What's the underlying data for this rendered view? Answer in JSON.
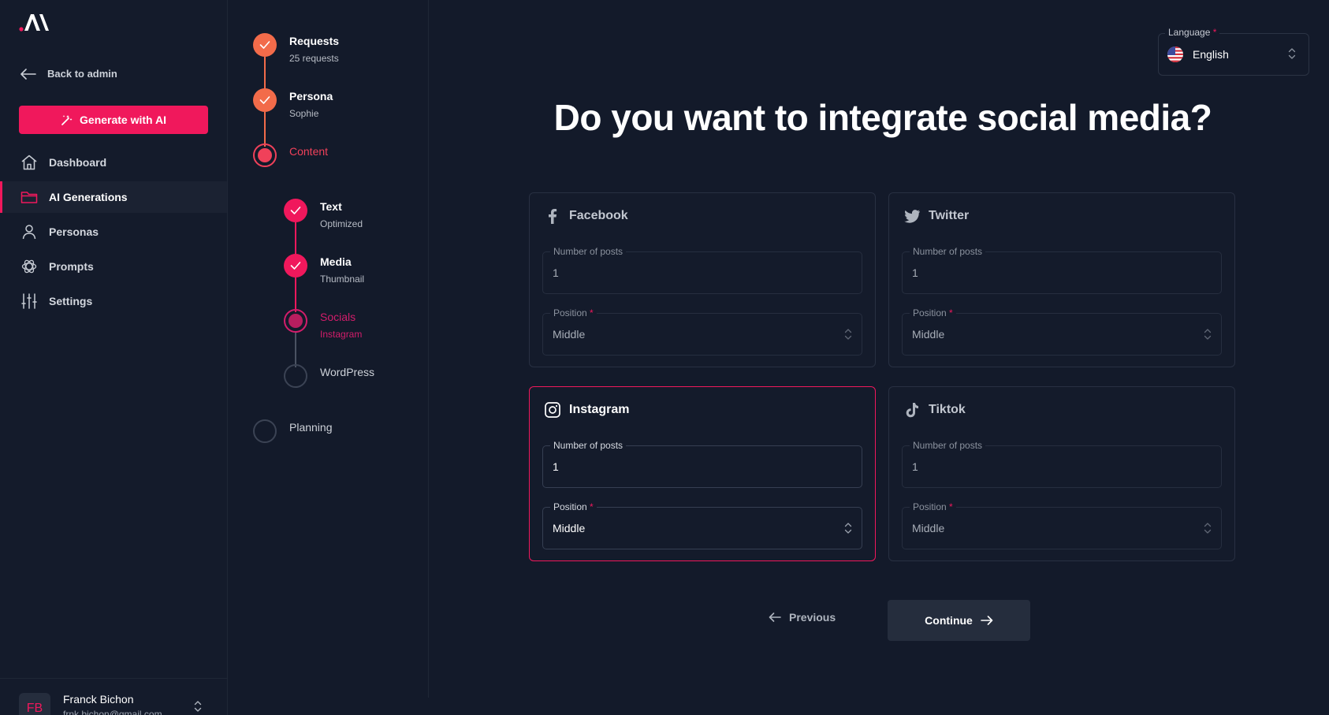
{
  "app": {
    "logo_text": ".AI"
  },
  "sidebar": {
    "back_label": "Back to admin",
    "generate_label": "Generate with AI",
    "items": [
      {
        "label": "Dashboard",
        "icon": "home-icon"
      },
      {
        "label": "AI Generations",
        "icon": "folder-icon",
        "active": true
      },
      {
        "label": "Personas",
        "icon": "user-icon"
      },
      {
        "label": "Prompts",
        "icon": "openai-icon"
      },
      {
        "label": "Settings",
        "icon": "sliders-icon"
      }
    ],
    "user": {
      "initials": "FB",
      "name": "Franck Bichon",
      "email": "frnk.bichon@gmail.com"
    }
  },
  "stepper": {
    "steps": [
      {
        "title": "Requests",
        "subtitle": "25 requests",
        "status": "done"
      },
      {
        "title": "Persona",
        "subtitle": "Sophie",
        "status": "done"
      },
      {
        "title": "Content",
        "subtitle": "",
        "status": "current"
      },
      {
        "title": "Planning",
        "subtitle": "",
        "status": "pending"
      }
    ],
    "substeps": [
      {
        "title": "Text",
        "subtitle": "Optimized",
        "status": "done"
      },
      {
        "title": "Media",
        "subtitle": "Thumbnail",
        "status": "done"
      },
      {
        "title": "Socials",
        "subtitle": "Instagram",
        "status": "current"
      },
      {
        "title": "WordPress",
        "subtitle": "",
        "status": "pending"
      }
    ]
  },
  "language": {
    "label": "Language",
    "required": "*",
    "value": "English"
  },
  "main": {
    "headline": "Do you want to integrate social media?",
    "cards": [
      {
        "name": "Facebook",
        "icon": "facebook-icon",
        "posts_label": "Number of posts",
        "posts": "1",
        "position_label": "Position",
        "position": "Middle",
        "selected": false
      },
      {
        "name": "Twitter",
        "icon": "twitter-icon",
        "posts_label": "Number of posts",
        "posts": "1",
        "position_label": "Position",
        "position": "Middle",
        "selected": false
      },
      {
        "name": "Instagram",
        "icon": "instagram-icon",
        "posts_label": "Number of posts",
        "posts": "1",
        "position_label": "Position",
        "position": "Middle",
        "selected": true
      },
      {
        "name": "Tiktok",
        "icon": "tiktok-icon",
        "posts_label": "Number of posts",
        "posts": "1",
        "position_label": "Position",
        "position": "Middle",
        "selected": false
      }
    ],
    "previous_label": "Previous",
    "continue_label": "Continue"
  },
  "colors": {
    "accent": "#f0185c",
    "step_orange": "#f26b4a",
    "background": "#131a2a"
  }
}
